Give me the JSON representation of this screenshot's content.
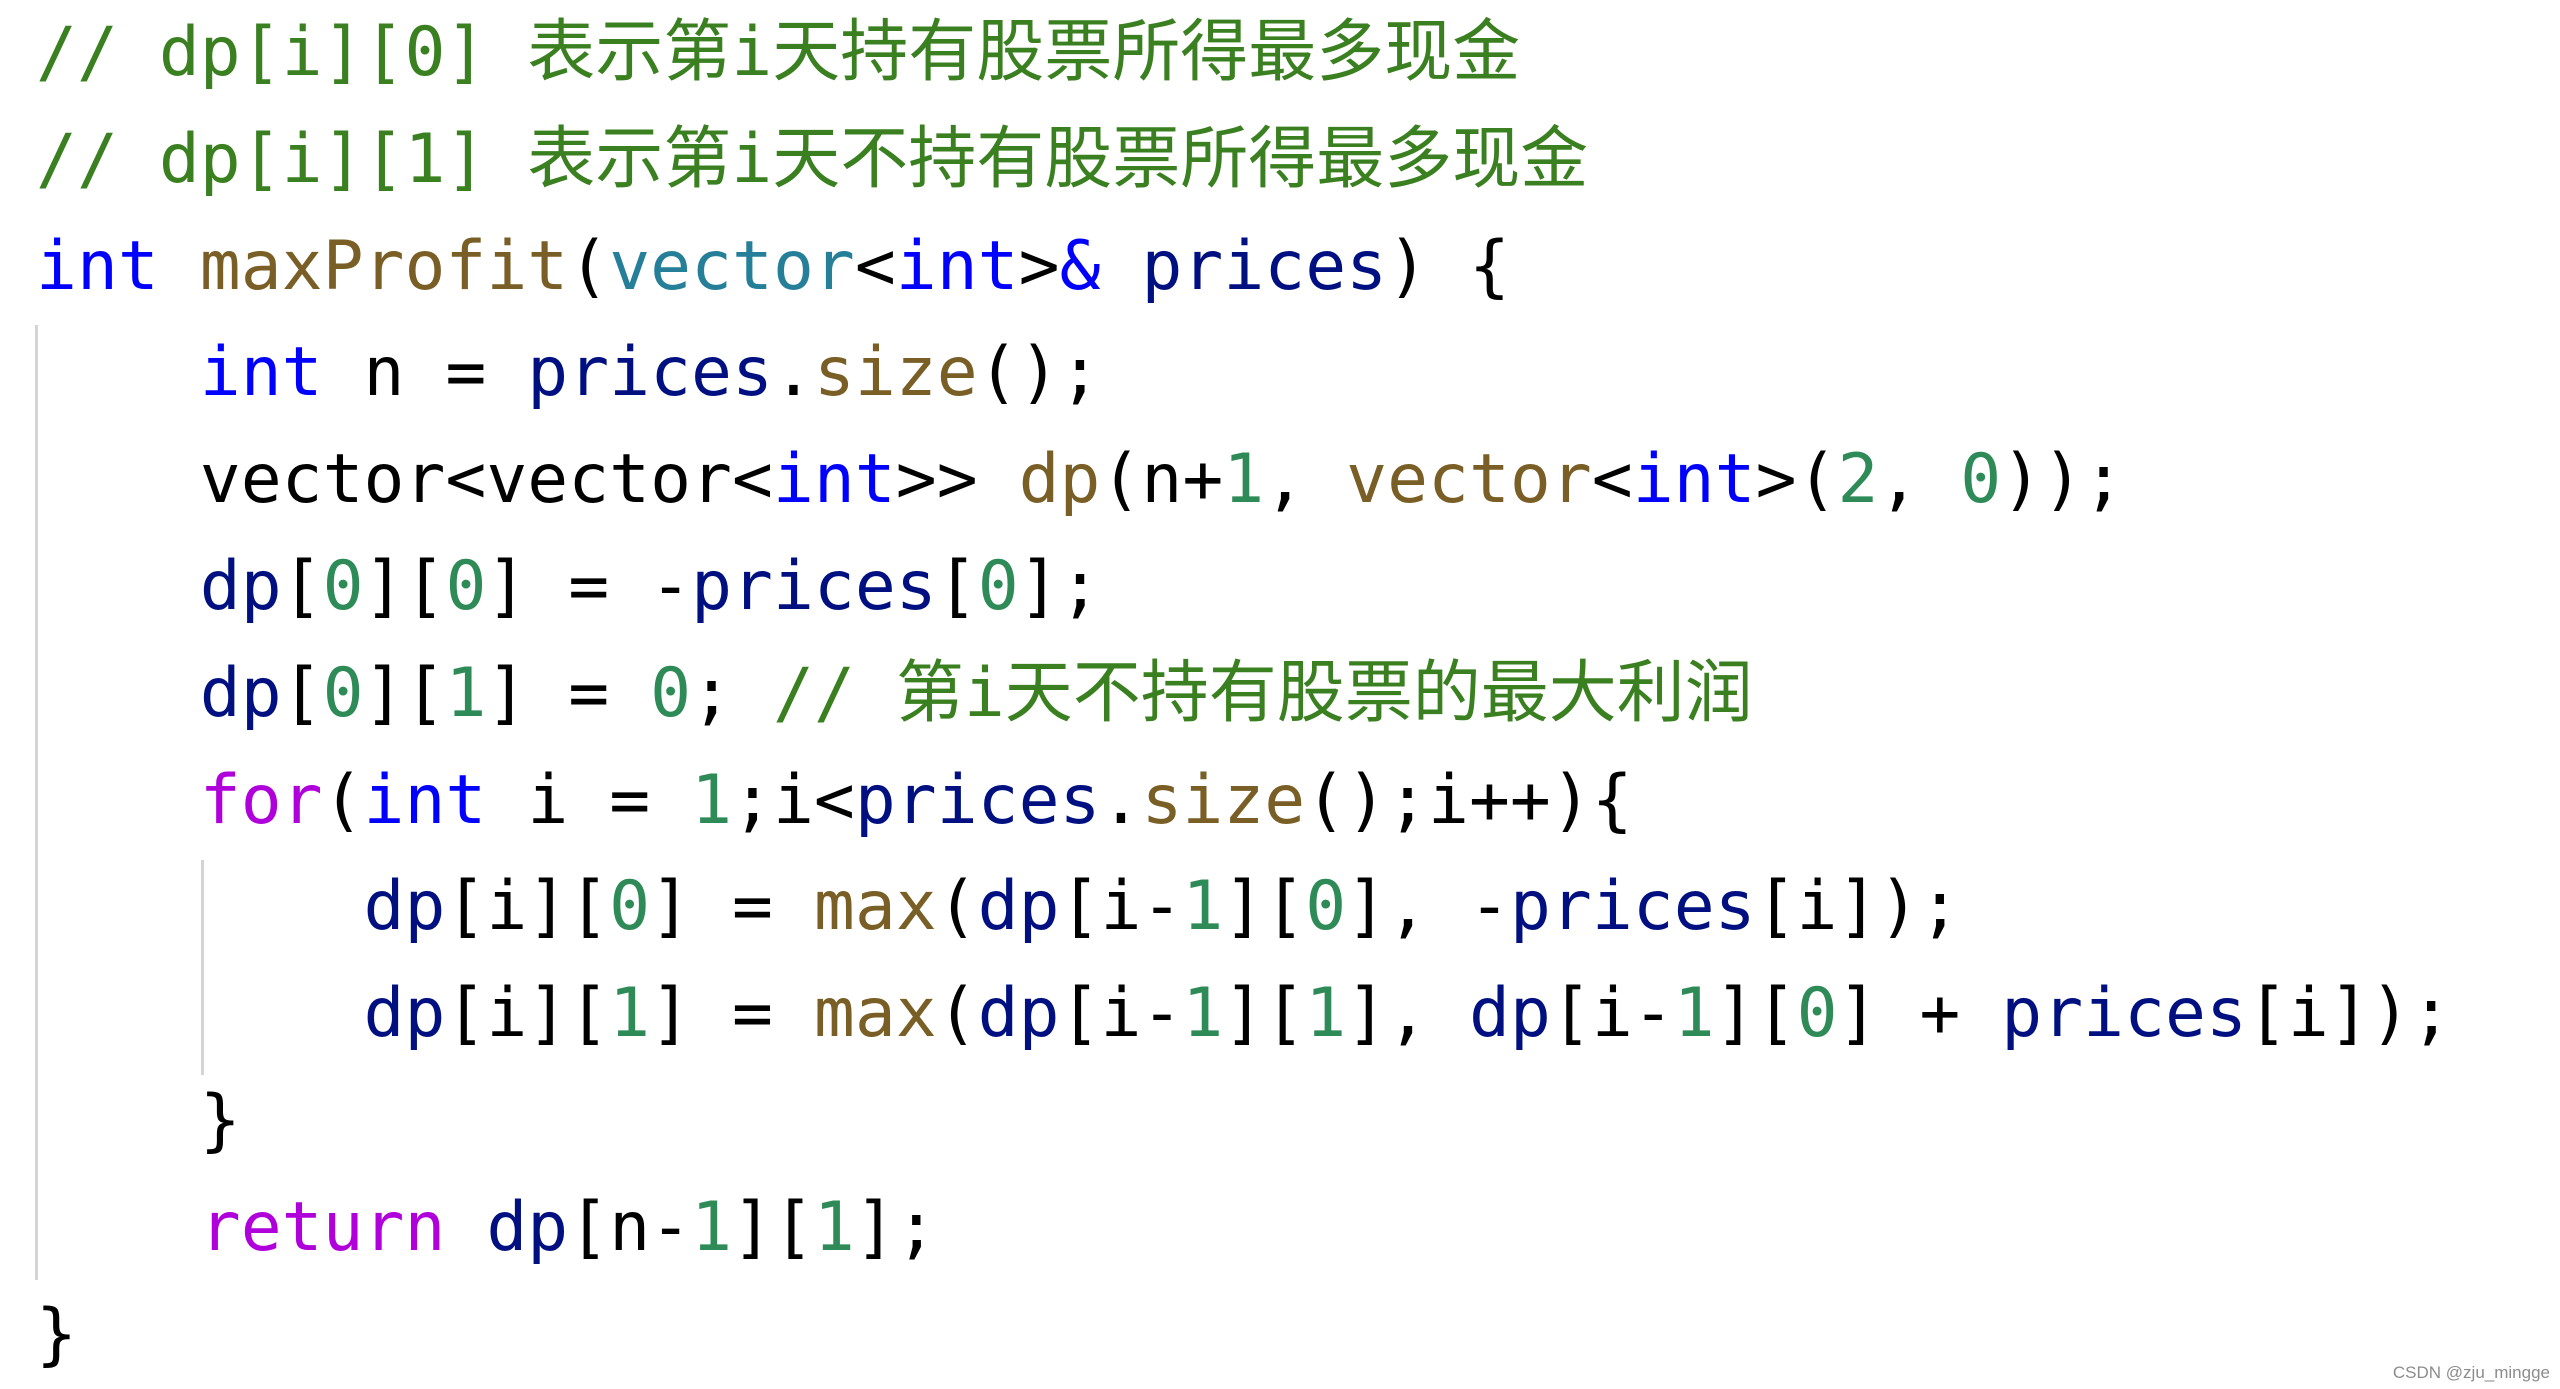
{
  "colors": {
    "comment": "#3a8020",
    "keyword": "#0000ff",
    "control": "#af00db",
    "function": "#795e26",
    "type": "#267f99",
    "variable": "#001080",
    "number": "#2e8b57",
    "plain": "#000000",
    "indent_guide": "#d4d4d4",
    "background": "#ffffff"
  },
  "code": {
    "language": "cpp",
    "lines": [
      {
        "indent": 0,
        "tokens": [
          {
            "t": "comment",
            "v": "// dp[i][0] 表示第i天持有股票所得最多现金"
          }
        ]
      },
      {
        "indent": 0,
        "tokens": [
          {
            "t": "comment",
            "v": "// dp[i][1] 表示第i天不持有股票所得最多现金"
          }
        ]
      },
      {
        "indent": 0,
        "tokens": [
          {
            "t": "keyword",
            "v": "int"
          },
          {
            "t": "plain",
            "v": " "
          },
          {
            "t": "function",
            "v": "maxProfit"
          },
          {
            "t": "plain",
            "v": "("
          },
          {
            "t": "type",
            "v": "vector"
          },
          {
            "t": "plain",
            "v": "<"
          },
          {
            "t": "keyword",
            "v": "int"
          },
          {
            "t": "plain",
            "v": ">"
          },
          {
            "t": "keyword",
            "v": "&"
          },
          {
            "t": "plain",
            "v": " "
          },
          {
            "t": "variable",
            "v": "prices"
          },
          {
            "t": "plain",
            "v": ") {"
          }
        ]
      },
      {
        "indent": 1,
        "tokens": [
          {
            "t": "keyword",
            "v": "int"
          },
          {
            "t": "plain",
            "v": " n = "
          },
          {
            "t": "variable",
            "v": "prices"
          },
          {
            "t": "plain",
            "v": "."
          },
          {
            "t": "function",
            "v": "size"
          },
          {
            "t": "plain",
            "v": "();"
          }
        ]
      },
      {
        "indent": 1,
        "tokens": [
          {
            "t": "plain",
            "v": "vector<vector<"
          },
          {
            "t": "keyword",
            "v": "int"
          },
          {
            "t": "plain",
            "v": ">> "
          },
          {
            "t": "function",
            "v": "dp"
          },
          {
            "t": "plain",
            "v": "(n+"
          },
          {
            "t": "number",
            "v": "1"
          },
          {
            "t": "plain",
            "v": ", "
          },
          {
            "t": "function",
            "v": "vector"
          },
          {
            "t": "plain",
            "v": "<"
          },
          {
            "t": "keyword",
            "v": "int"
          },
          {
            "t": "plain",
            "v": ">("
          },
          {
            "t": "number",
            "v": "2"
          },
          {
            "t": "plain",
            "v": ", "
          },
          {
            "t": "number",
            "v": "0"
          },
          {
            "t": "plain",
            "v": "));"
          }
        ]
      },
      {
        "indent": 1,
        "tokens": [
          {
            "t": "variable",
            "v": "dp"
          },
          {
            "t": "plain",
            "v": "["
          },
          {
            "t": "number",
            "v": "0"
          },
          {
            "t": "plain",
            "v": "]["
          },
          {
            "t": "number",
            "v": "0"
          },
          {
            "t": "plain",
            "v": "] = -"
          },
          {
            "t": "variable",
            "v": "prices"
          },
          {
            "t": "plain",
            "v": "["
          },
          {
            "t": "number",
            "v": "0"
          },
          {
            "t": "plain",
            "v": "];"
          }
        ]
      },
      {
        "indent": 1,
        "tokens": [
          {
            "t": "variable",
            "v": "dp"
          },
          {
            "t": "plain",
            "v": "["
          },
          {
            "t": "number",
            "v": "0"
          },
          {
            "t": "plain",
            "v": "]["
          },
          {
            "t": "number",
            "v": "1"
          },
          {
            "t": "plain",
            "v": "] = "
          },
          {
            "t": "number",
            "v": "0"
          },
          {
            "t": "plain",
            "v": "; "
          },
          {
            "t": "comment",
            "v": "// 第i天不持有股票的最大利润"
          }
        ]
      },
      {
        "indent": 1,
        "tokens": [
          {
            "t": "control",
            "v": "for"
          },
          {
            "t": "plain",
            "v": "("
          },
          {
            "t": "keyword",
            "v": "int"
          },
          {
            "t": "plain",
            "v": " i = "
          },
          {
            "t": "number",
            "v": "1"
          },
          {
            "t": "plain",
            "v": ";i<"
          },
          {
            "t": "variable",
            "v": "prices"
          },
          {
            "t": "plain",
            "v": "."
          },
          {
            "t": "function",
            "v": "size"
          },
          {
            "t": "plain",
            "v": "();i++){"
          }
        ]
      },
      {
        "indent": 2,
        "tokens": [
          {
            "t": "variable",
            "v": "dp"
          },
          {
            "t": "plain",
            "v": "[i]["
          },
          {
            "t": "number",
            "v": "0"
          },
          {
            "t": "plain",
            "v": "] = "
          },
          {
            "t": "function",
            "v": "max"
          },
          {
            "t": "plain",
            "v": "("
          },
          {
            "t": "variable",
            "v": "dp"
          },
          {
            "t": "plain",
            "v": "[i-"
          },
          {
            "t": "number",
            "v": "1"
          },
          {
            "t": "plain",
            "v": "]["
          },
          {
            "t": "number",
            "v": "0"
          },
          {
            "t": "plain",
            "v": "], -"
          },
          {
            "t": "variable",
            "v": "prices"
          },
          {
            "t": "plain",
            "v": "[i]);"
          }
        ]
      },
      {
        "indent": 2,
        "tokens": [
          {
            "t": "variable",
            "v": "dp"
          },
          {
            "t": "plain",
            "v": "[i]["
          },
          {
            "t": "number",
            "v": "1"
          },
          {
            "t": "plain",
            "v": "] = "
          },
          {
            "t": "function",
            "v": "max"
          },
          {
            "t": "plain",
            "v": "("
          },
          {
            "t": "variable",
            "v": "dp"
          },
          {
            "t": "plain",
            "v": "[i-"
          },
          {
            "t": "number",
            "v": "1"
          },
          {
            "t": "plain",
            "v": "]["
          },
          {
            "t": "number",
            "v": "1"
          },
          {
            "t": "plain",
            "v": "], "
          },
          {
            "t": "variable",
            "v": "dp"
          },
          {
            "t": "plain",
            "v": "[i-"
          },
          {
            "t": "number",
            "v": "1"
          },
          {
            "t": "plain",
            "v": "]["
          },
          {
            "t": "number",
            "v": "0"
          },
          {
            "t": "plain",
            "v": "] + "
          },
          {
            "t": "variable",
            "v": "prices"
          },
          {
            "t": "plain",
            "v": "[i]);"
          }
        ]
      },
      {
        "indent": 1,
        "tokens": [
          {
            "t": "plain",
            "v": "}"
          }
        ]
      },
      {
        "indent": 1,
        "tokens": [
          {
            "t": "control",
            "v": "return"
          },
          {
            "t": "plain",
            "v": " "
          },
          {
            "t": "variable",
            "v": "dp"
          },
          {
            "t": "plain",
            "v": "[n-"
          },
          {
            "t": "number",
            "v": "1"
          },
          {
            "t": "plain",
            "v": "]["
          },
          {
            "t": "number",
            "v": "1"
          },
          {
            "t": "plain",
            "v": "];"
          }
        ]
      },
      {
        "indent": 0,
        "tokens": [
          {
            "t": "plain",
            "v": "}"
          }
        ]
      }
    ]
  },
  "watermark": {
    "text": "CSDN @zju_mingge"
  }
}
